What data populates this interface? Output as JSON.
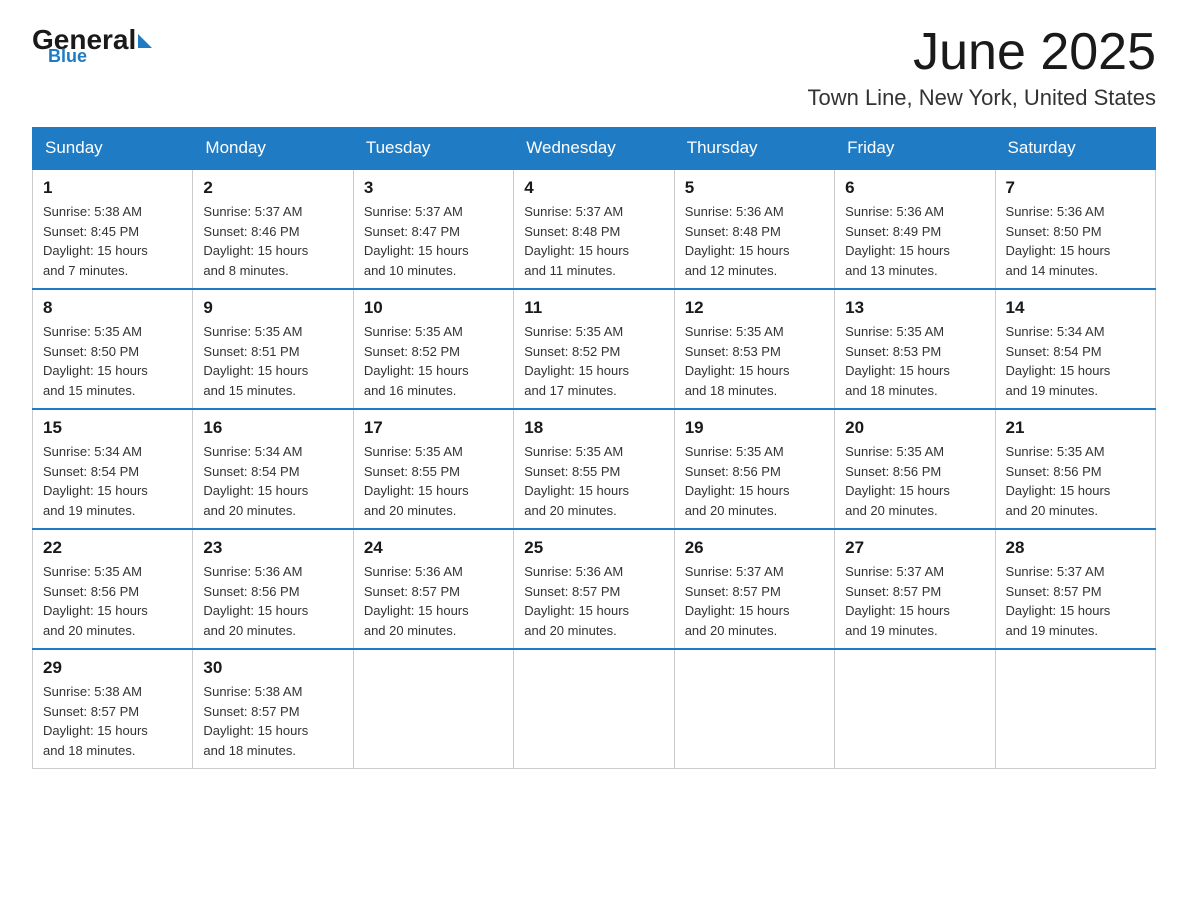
{
  "header": {
    "logo_general": "General",
    "logo_blue": "Blue",
    "month_title": "June 2025",
    "location": "Town Line, New York, United States"
  },
  "weekdays": [
    "Sunday",
    "Monday",
    "Tuesday",
    "Wednesday",
    "Thursday",
    "Friday",
    "Saturday"
  ],
  "weeks": [
    [
      {
        "day": "1",
        "sunrise": "5:38 AM",
        "sunset": "8:45 PM",
        "daylight": "15 hours and 7 minutes."
      },
      {
        "day": "2",
        "sunrise": "5:37 AM",
        "sunset": "8:46 PM",
        "daylight": "15 hours and 8 minutes."
      },
      {
        "day": "3",
        "sunrise": "5:37 AM",
        "sunset": "8:47 PM",
        "daylight": "15 hours and 10 minutes."
      },
      {
        "day": "4",
        "sunrise": "5:37 AM",
        "sunset": "8:48 PM",
        "daylight": "15 hours and 11 minutes."
      },
      {
        "day": "5",
        "sunrise": "5:36 AM",
        "sunset": "8:48 PM",
        "daylight": "15 hours and 12 minutes."
      },
      {
        "day": "6",
        "sunrise": "5:36 AM",
        "sunset": "8:49 PM",
        "daylight": "15 hours and 13 minutes."
      },
      {
        "day": "7",
        "sunrise": "5:36 AM",
        "sunset": "8:50 PM",
        "daylight": "15 hours and 14 minutes."
      }
    ],
    [
      {
        "day": "8",
        "sunrise": "5:35 AM",
        "sunset": "8:50 PM",
        "daylight": "15 hours and 15 minutes."
      },
      {
        "day": "9",
        "sunrise": "5:35 AM",
        "sunset": "8:51 PM",
        "daylight": "15 hours and 15 minutes."
      },
      {
        "day": "10",
        "sunrise": "5:35 AM",
        "sunset": "8:52 PM",
        "daylight": "15 hours and 16 minutes."
      },
      {
        "day": "11",
        "sunrise": "5:35 AM",
        "sunset": "8:52 PM",
        "daylight": "15 hours and 17 minutes."
      },
      {
        "day": "12",
        "sunrise": "5:35 AM",
        "sunset": "8:53 PM",
        "daylight": "15 hours and 18 minutes."
      },
      {
        "day": "13",
        "sunrise": "5:35 AM",
        "sunset": "8:53 PM",
        "daylight": "15 hours and 18 minutes."
      },
      {
        "day": "14",
        "sunrise": "5:34 AM",
        "sunset": "8:54 PM",
        "daylight": "15 hours and 19 minutes."
      }
    ],
    [
      {
        "day": "15",
        "sunrise": "5:34 AM",
        "sunset": "8:54 PM",
        "daylight": "15 hours and 19 minutes."
      },
      {
        "day": "16",
        "sunrise": "5:34 AM",
        "sunset": "8:54 PM",
        "daylight": "15 hours and 20 minutes."
      },
      {
        "day": "17",
        "sunrise": "5:35 AM",
        "sunset": "8:55 PM",
        "daylight": "15 hours and 20 minutes."
      },
      {
        "day": "18",
        "sunrise": "5:35 AM",
        "sunset": "8:55 PM",
        "daylight": "15 hours and 20 minutes."
      },
      {
        "day": "19",
        "sunrise": "5:35 AM",
        "sunset": "8:56 PM",
        "daylight": "15 hours and 20 minutes."
      },
      {
        "day": "20",
        "sunrise": "5:35 AM",
        "sunset": "8:56 PM",
        "daylight": "15 hours and 20 minutes."
      },
      {
        "day": "21",
        "sunrise": "5:35 AM",
        "sunset": "8:56 PM",
        "daylight": "15 hours and 20 minutes."
      }
    ],
    [
      {
        "day": "22",
        "sunrise": "5:35 AM",
        "sunset": "8:56 PM",
        "daylight": "15 hours and 20 minutes."
      },
      {
        "day": "23",
        "sunrise": "5:36 AM",
        "sunset": "8:56 PM",
        "daylight": "15 hours and 20 minutes."
      },
      {
        "day": "24",
        "sunrise": "5:36 AM",
        "sunset": "8:57 PM",
        "daylight": "15 hours and 20 minutes."
      },
      {
        "day": "25",
        "sunrise": "5:36 AM",
        "sunset": "8:57 PM",
        "daylight": "15 hours and 20 minutes."
      },
      {
        "day": "26",
        "sunrise": "5:37 AM",
        "sunset": "8:57 PM",
        "daylight": "15 hours and 20 minutes."
      },
      {
        "day": "27",
        "sunrise": "5:37 AM",
        "sunset": "8:57 PM",
        "daylight": "15 hours and 19 minutes."
      },
      {
        "day": "28",
        "sunrise": "5:37 AM",
        "sunset": "8:57 PM",
        "daylight": "15 hours and 19 minutes."
      }
    ],
    [
      {
        "day": "29",
        "sunrise": "5:38 AM",
        "sunset": "8:57 PM",
        "daylight": "15 hours and 18 minutes."
      },
      {
        "day": "30",
        "sunrise": "5:38 AM",
        "sunset": "8:57 PM",
        "daylight": "15 hours and 18 minutes."
      },
      null,
      null,
      null,
      null,
      null
    ]
  ],
  "labels": {
    "sunrise": "Sunrise:",
    "sunset": "Sunset:",
    "daylight": "Daylight:"
  }
}
